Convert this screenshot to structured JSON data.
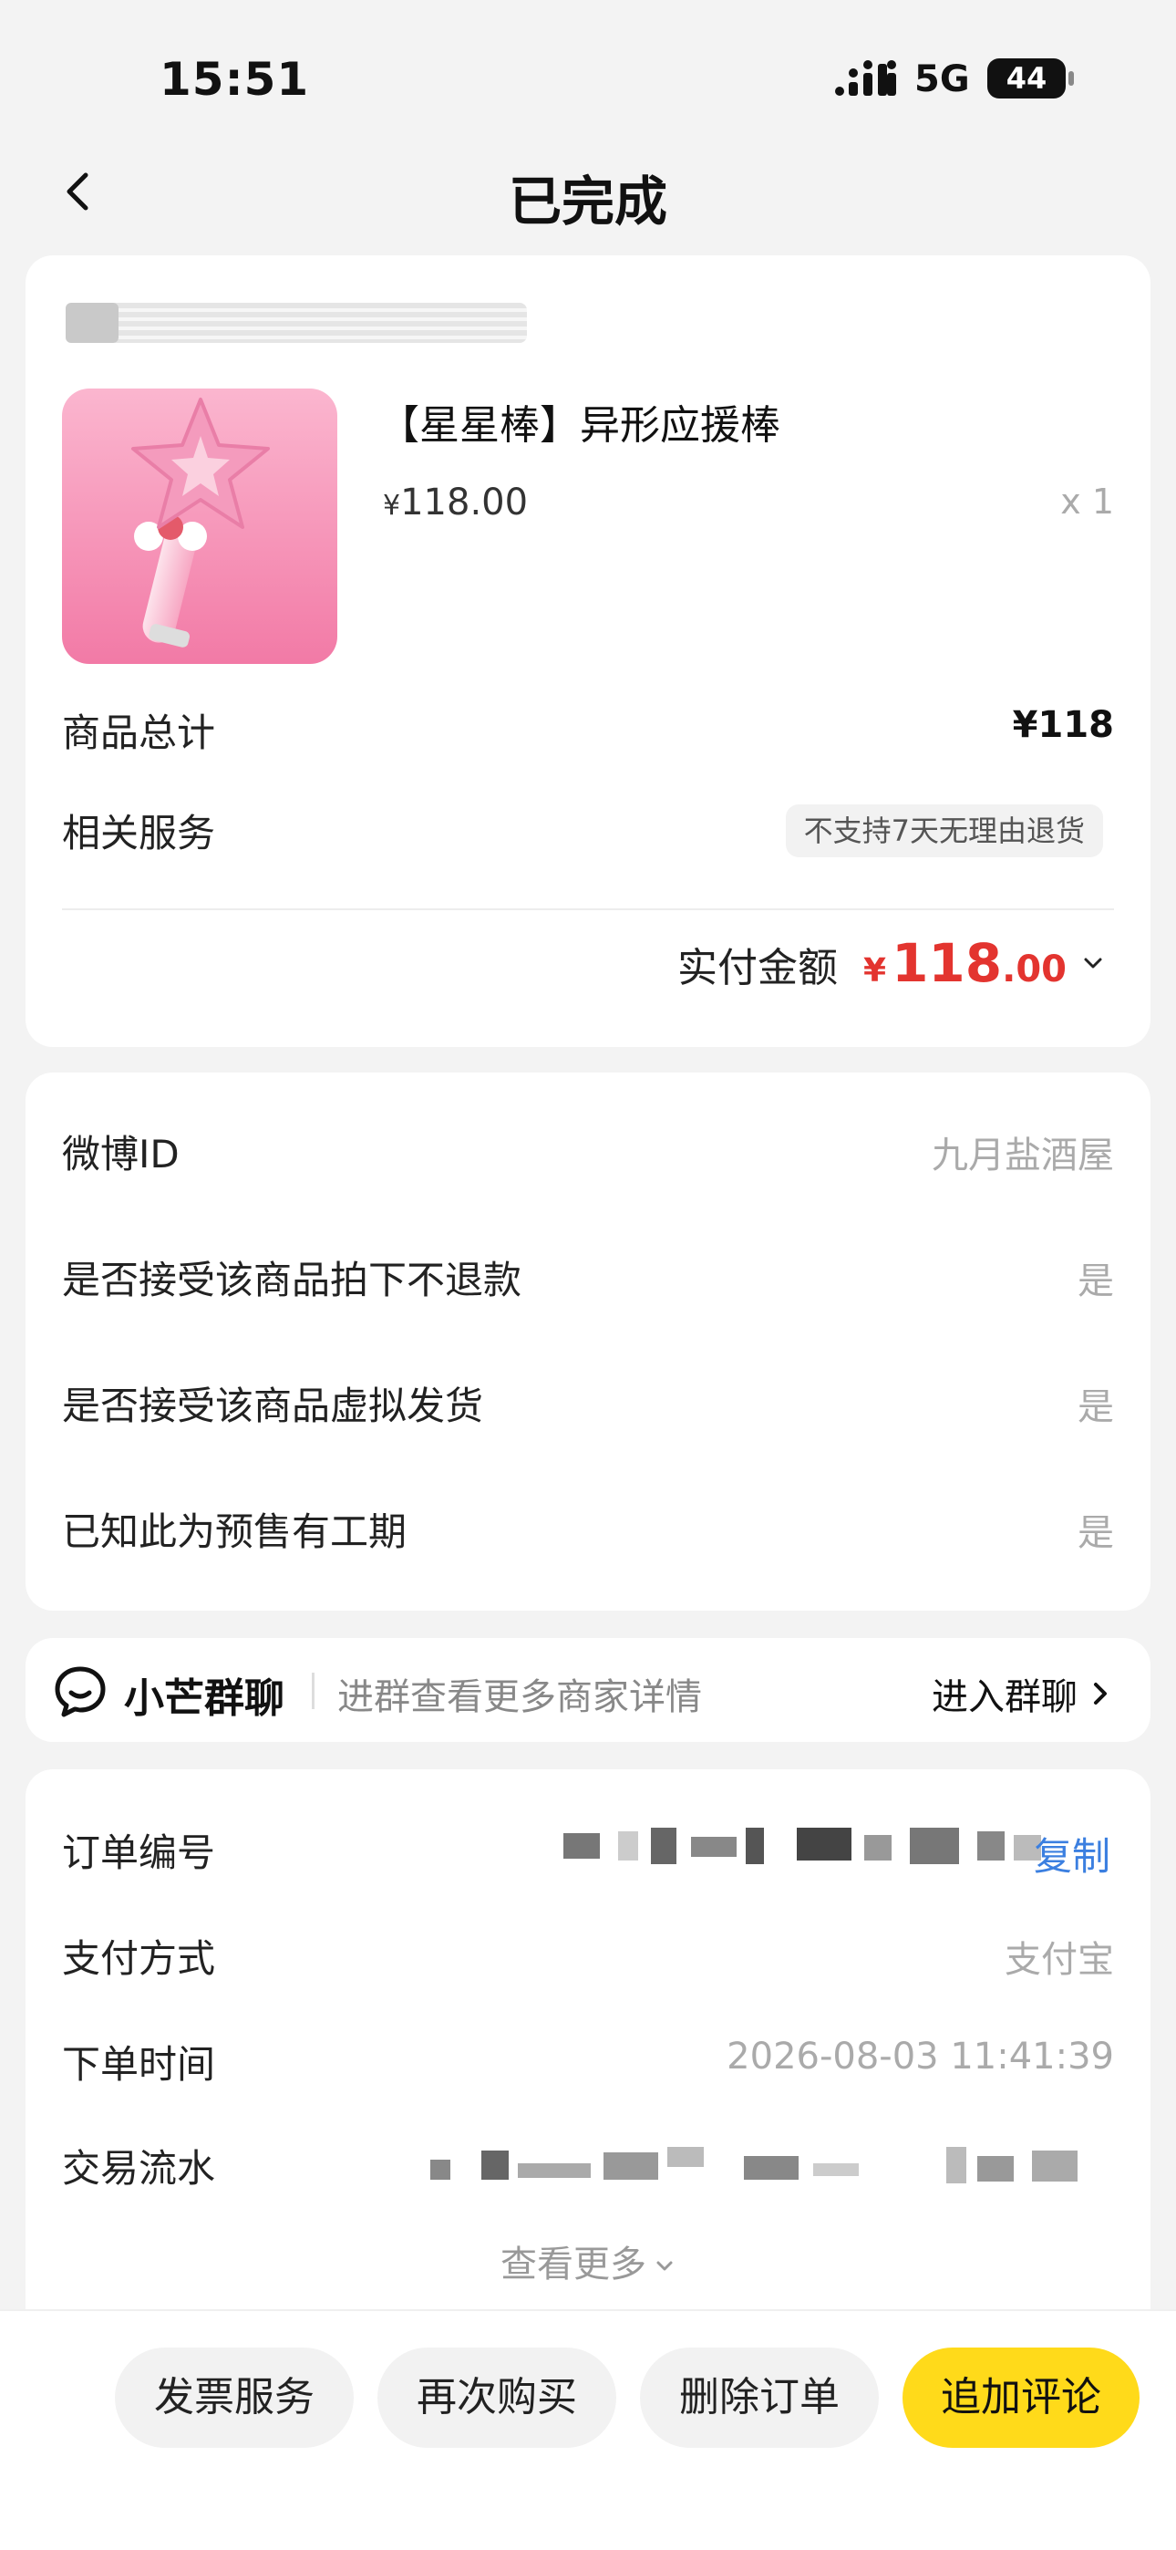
{
  "status_bar": {
    "time": "15:51",
    "network": "5G",
    "battery": "44"
  },
  "nav": {
    "title": "已完成"
  },
  "order": {
    "product_title": "【星星棒】异形应援棒",
    "price_symbol": "¥",
    "price": "118.00",
    "quantity": "x 1",
    "total_label": "商品总计",
    "total_value": "¥118",
    "service_label": "相关服务",
    "service_badge": "不支持7天无理由退货",
    "paid_label": "实付金额",
    "paid_symbol": "¥",
    "paid_integer": "118",
    "paid_decimal": ".00"
  },
  "info_fields": [
    {
      "label": "微博ID",
      "value": "九月盐酒屋"
    },
    {
      "label": "是否接受该商品拍下不退款",
      "value": "是"
    },
    {
      "label": "是否接受该商品虚拟发货",
      "value": "是"
    },
    {
      "label": "已知此为预售有工期",
      "value": "是"
    }
  ],
  "group_chat": {
    "title": "小芒群聊",
    "desc": "进群查看更多商家详情",
    "enter": "进入群聊"
  },
  "details": {
    "order_no_label": "订单编号",
    "copy": "复制",
    "pay_method_label": "支付方式",
    "pay_method_value": "支付宝",
    "order_time_label": "下单时间",
    "order_time_value": "2026-08-03 11:41:39",
    "transaction_label": "交易流水",
    "more": "查看更多"
  },
  "actions": {
    "invoice": "发票服务",
    "rebuy": "再次购买",
    "delete": "删除订单",
    "review": "追加评论"
  },
  "colors": {
    "accent_yellow": "#ffda1a",
    "price_red": "#e3342f",
    "link_blue": "#3b7fe0"
  }
}
